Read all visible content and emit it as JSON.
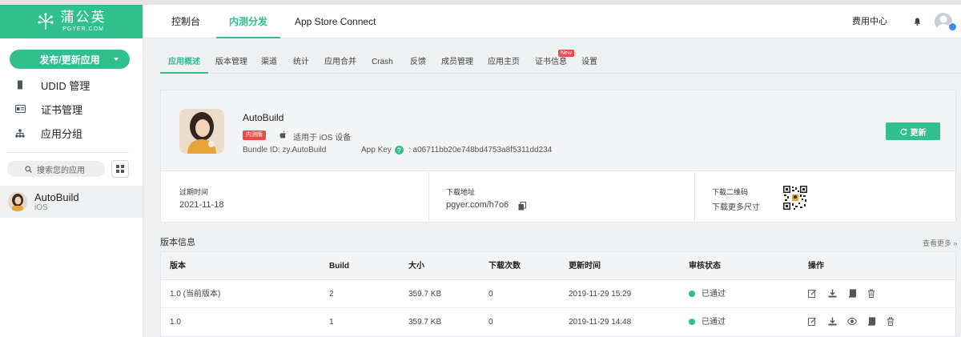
{
  "brand": {
    "name_cn": "蒲公英",
    "name_en": "PGYER.COM",
    "color": "#2fc08d"
  },
  "sidebar": {
    "publish_label": "发布/更新应用",
    "items": [
      {
        "label": "UDID 管理",
        "icon": "phone-icon"
      },
      {
        "label": "证书管理",
        "icon": "id-card-icon"
      },
      {
        "label": "应用分组",
        "icon": "group-tree-icon"
      }
    ],
    "search_placeholder": "搜索您的应用",
    "apps": [
      {
        "name": "AutoBuild",
        "platform": "iOS"
      }
    ]
  },
  "topnav": {
    "items": [
      {
        "label": "控制台"
      },
      {
        "label": "内测分发"
      },
      {
        "label": "App Store Connect"
      }
    ],
    "active": "内测分发",
    "fee_label": "费用中心"
  },
  "subtabs": {
    "items": [
      "应用概述",
      "版本管理",
      "渠道",
      "统计",
      "应用合并",
      "Crash",
      "反馈",
      "成员管理",
      "应用主页",
      "证书信息",
      "设置"
    ],
    "active": "应用概述",
    "new_badge": "New"
  },
  "app": {
    "name": "AutoBuild",
    "badge": "内测版",
    "platform_text": "适用于 iOS 设备",
    "bundle_id": "Bundle ID:  zy.AutoBuild",
    "app_key_label": "App Key",
    "app_key_value": ":   a06711bb20e748bd4753a8f5311dd234",
    "update_label": "更新"
  },
  "info": {
    "expire": {
      "label": "过期时间",
      "value": "2021-11-18"
    },
    "download": {
      "label": "下载地址",
      "value": "pgyer.com/h7o6"
    },
    "qrcode": {
      "label": "下载二维码",
      "value": "下载更多尺寸"
    }
  },
  "versions": {
    "title": "版本信息",
    "see_more": "查看更多 »",
    "headers": [
      "版本",
      "Build",
      "大小",
      "下载次数",
      "更新时间",
      "审核状态",
      "操作"
    ],
    "rows": [
      {
        "version": "1.0 (当前版本)",
        "build": "2",
        "size": "359.7 KB",
        "downloads": "0",
        "updated": "2019-11-29 15:29",
        "status": "已通过"
      },
      {
        "version": "1.0",
        "build": "1",
        "size": "359.7 KB",
        "downloads": "0",
        "updated": "2019-11-29 14:48",
        "status": "已通过"
      }
    ]
  }
}
